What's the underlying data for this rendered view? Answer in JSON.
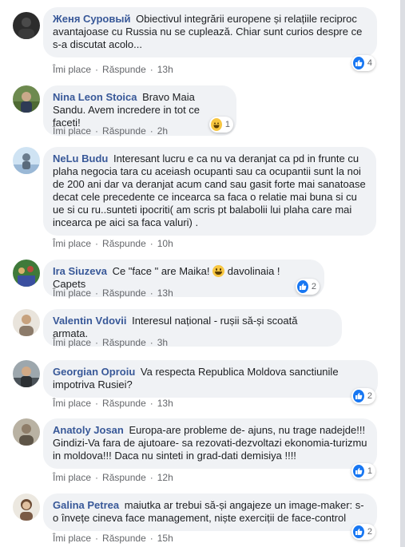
{
  "actions": {
    "like": "Îmi place",
    "reply": "Răspunde",
    "dot": "·"
  },
  "comments": [
    {
      "name": "Женя Суровый",
      "text": "Obiectivul integrării europene și relațiile reciproc avantajoase cu Russia nu se cuplează. Chiar sunt curios despre ce s-a discutat acolo...",
      "time": "13h",
      "reaction_icon": "like-icon",
      "reaction_count": "4"
    },
    {
      "name": "Nina Leon Stoica",
      "text": "Bravo Maia Sandu. Avem incredere in tot ce faceti!",
      "time": "2h",
      "reaction_icon": "haha-icon",
      "reaction_count": "1"
    },
    {
      "name": "NeLu Budu",
      "text": "Interesant lucru e ca nu va deranjat ca pd in frunte cu plaha negocia tara cu aceiash ocupanti sau ca ocupantii sunt la noi de 200 ani dar va deranjat acum cand sau gasit forte mai sanatoase decat cele precedente ce incearca sa faca o relatie mai buna si cu ue si cu ru..sunteti ipocriti( am scris pt balabolii lui plaha care mai incearca pe aici sa faca valuri) .",
      "time": "10h"
    },
    {
      "name": "Ira Siuzeva",
      "text_a": "Ce \"face \" are Maika!",
      "emoji_icon": "grinning-face-emoji-icon",
      "text_b": "davolinaia ! Capets",
      "time": "13h",
      "reaction_icon": "like-icon",
      "reaction_count": "2"
    },
    {
      "name": "Valentin Vdovii",
      "text": "Interesul național - rușii să-și scoată armata.",
      "time": "3h"
    },
    {
      "name": "Georgian Oproiu",
      "text": "Va respecta Republica Moldova sanctiunile impotriva Rusiei?",
      "time": "13h",
      "reaction_icon": "like-icon",
      "reaction_count": "2"
    },
    {
      "name": "Anatoly Josan",
      "text": "Europa-are probleme de- ajuns, nu trage nadejde!!! Gindizi-Va fara de ajutoare- sa rezovati-dezvoltazi ekonomia-turizmu in moldova!!! Daca nu sinteti in grad-dati demisiya !!!!",
      "time": "12h",
      "reaction_icon": "like-icon",
      "reaction_count": "1"
    },
    {
      "name": "Galina Petrea",
      "text": "maiutka ar trebui să-și angajeze un image-maker: s-o învețe cineva face management, niște exerciții de face-control",
      "time": "15h",
      "reaction_icon": "like-icon",
      "reaction_count": "2"
    }
  ]
}
